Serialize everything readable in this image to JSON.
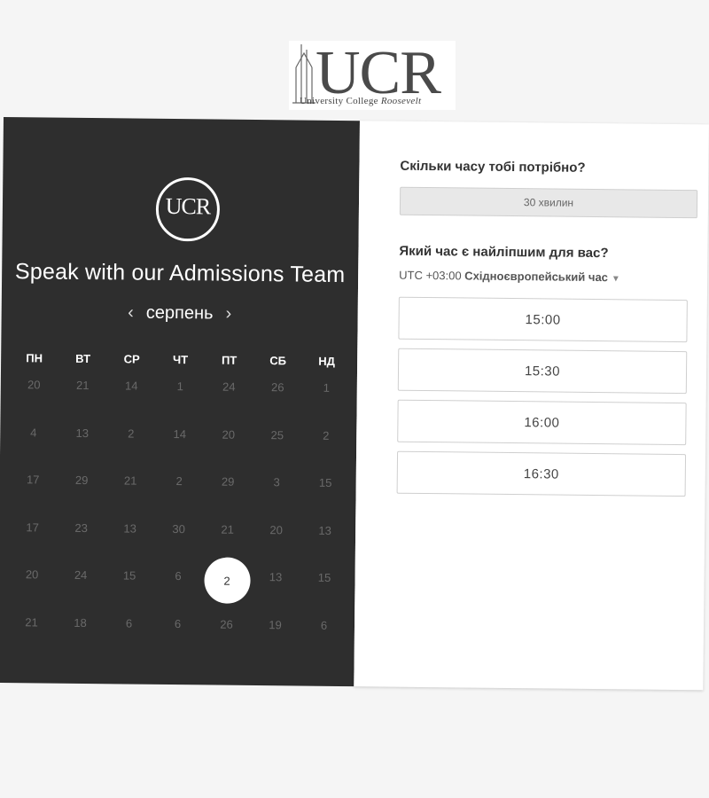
{
  "logo": {
    "main": "UCR",
    "subtitle_a": "University College ",
    "subtitle_b": "Roosevelt"
  },
  "scheduler": {
    "title": "Speak with our Admissions Team",
    "month": "серпень",
    "prev_icon": "chevron-left-icon",
    "next_icon": "chevron-right-icon",
    "weekdays": [
      "ПН",
      "ВТ",
      "СР",
      "ЧТ",
      "ПТ",
      "СБ",
      "НД"
    ],
    "days": [
      "20",
      "21",
      "14",
      "1",
      "24",
      "26",
      "1",
      "4",
      "13",
      "2",
      "14",
      "20",
      "25",
      "2",
      "17",
      "29",
      "21",
      "2",
      "29",
      "3",
      "15",
      "17",
      "23",
      "13",
      "30",
      "21",
      "20",
      "13",
      "20",
      "24",
      "15",
      "6",
      "2",
      "13",
      "15",
      "21",
      "18",
      "6",
      "6",
      "26",
      "19",
      "6"
    ],
    "selected_day": "2"
  },
  "right": {
    "duration_question": "Скільки часу тобі потрібно?",
    "duration_value": "30 хвилин",
    "time_question": "Який час є найліпшим для вас?",
    "tz_offset": "UTC +03:00 ",
    "tz_name": "Східноєвропейський час",
    "slots": [
      "15:00",
      "15:30",
      "16:00",
      "16:30"
    ]
  },
  "colors": {
    "panel_dark": "#2e2e2e",
    "page_bg": "#f5f5f5"
  }
}
